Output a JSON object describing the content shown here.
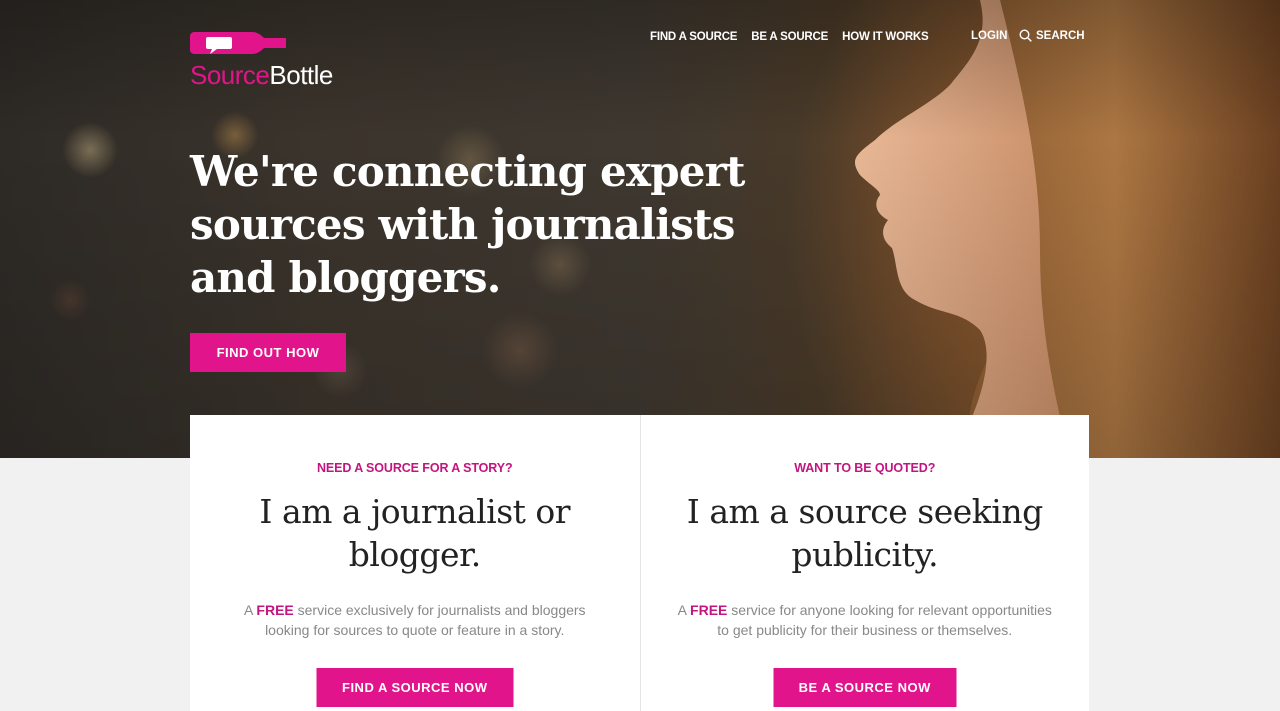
{
  "brand": {
    "logo_word1": "Source",
    "logo_word2": "Bottle",
    "accent": "#e2148b"
  },
  "nav": {
    "items": [
      "FIND A SOURCE",
      "BE A SOURCE",
      "HOW IT WORKS"
    ],
    "login": "LOGIN",
    "search": "SEARCH"
  },
  "hero": {
    "headline_line1": "We're connecting expert",
    "headline_line2": "sources with journalists",
    "headline_line3": "and bloggers.",
    "cta": "FIND OUT HOW"
  },
  "cards": [
    {
      "eyebrow": "NEED A SOURCE FOR A STORY?",
      "title_line1": "I am a journalist or",
      "title_line2": "blogger.",
      "desc_prefix": "A",
      "desc_free": "FREE",
      "desc_line1": "service exclusively for journalists and bloggers",
      "desc_line2": "looking for sources to quote or feature in a story.",
      "button": "FIND A SOURCE NOW"
    },
    {
      "eyebrow": "WANT TO BE QUOTED?",
      "title_line1": "I am a source seeking",
      "title_line2": "publicity.",
      "desc_prefix": "A",
      "desc_free": "FREE",
      "desc_line1": "service for anyone looking for relevant opportunities",
      "desc_line2": "to get publicity for their business or themselves.",
      "button": "BE A SOURCE NOW"
    }
  ]
}
